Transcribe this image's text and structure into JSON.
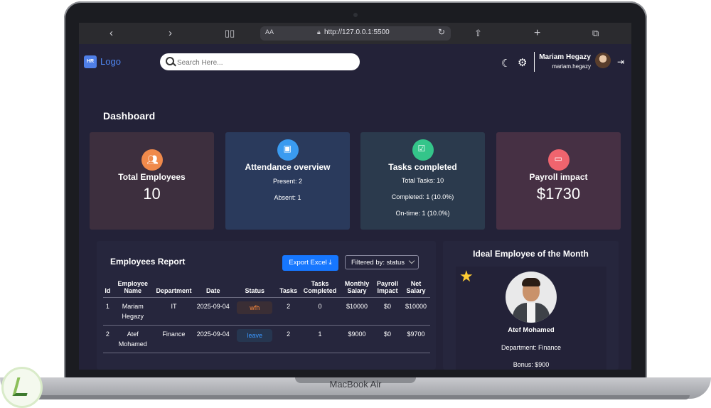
{
  "device": {
    "label": "MacBook Air"
  },
  "browser": {
    "text_size": "AA",
    "url": "http://127.0.0.1:5500"
  },
  "header": {
    "logo_badge": "HR",
    "logo_text": "Logo",
    "search_placeholder": "Search Here...",
    "user_name": "Mariam Hegazy",
    "user_handle": "mariam.hegazy"
  },
  "dashboard": {
    "title": "Dashboard",
    "cards": [
      {
        "title": "Total Employees",
        "value": "10",
        "color": "#f08a4b"
      },
      {
        "title": "Attendance overview",
        "present": "Present: 2",
        "absent": "Absent: 1",
        "color": "#3a9bf0"
      },
      {
        "title": "Tasks completed",
        "total": "Total Tasks: 10",
        "completed": "Completed: 1 (10.0%)",
        "ontime": "On-time: 1 (10.0%)",
        "color": "#34c58a"
      },
      {
        "title": "Payroll impact",
        "value": "$1730",
        "color": "#f0646e"
      }
    ]
  },
  "report": {
    "title": "Employees Report",
    "export_label": "Export Excel",
    "filter_label": "Filtered by: status",
    "columns": [
      "Id",
      "Employee Name",
      "Department",
      "Date",
      "Status",
      "Tasks",
      "Tasks Completed",
      "Monthly Salary",
      "Payroll Impact",
      "Net Salary"
    ],
    "rows": [
      {
        "id": "1",
        "name": "Mariam Hegazy",
        "department": "IT",
        "date": "2025-09-04",
        "status": "wfh",
        "tasks": "2",
        "completed": "0",
        "monthly": "$10000",
        "impact": "$0",
        "net": "$10000"
      },
      {
        "id": "2",
        "name": "Atef Mohamed",
        "department": "Finance",
        "date": "2025-09-04",
        "status": "leave",
        "tasks": "2",
        "completed": "1",
        "monthly": "$9000",
        "impact": "$0",
        "net": "$9700"
      }
    ]
  },
  "ideal": {
    "title": "Ideal Employee of the Month",
    "name": "Atef Mohamed",
    "department": "Department: Finance",
    "bonus": "Bonus: $900"
  }
}
